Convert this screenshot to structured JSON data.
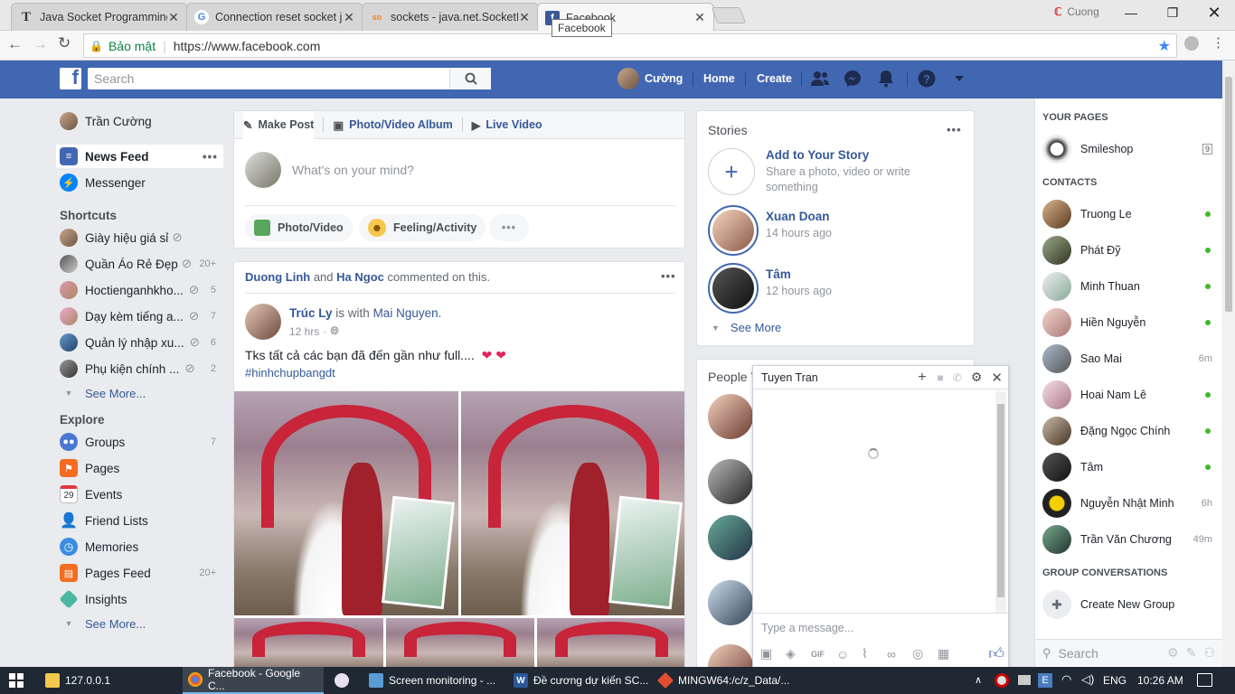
{
  "browser": {
    "tabs": [
      {
        "title": "Java Socket Programming",
        "icon": "T"
      },
      {
        "title": "Connection reset socket j",
        "icon": "G"
      },
      {
        "title": "sockets - java.net.SocketE",
        "icon": "so"
      },
      {
        "title": "Facebook",
        "icon": "f"
      }
    ],
    "tooltip": "Facebook",
    "profile_name": "Cuong",
    "secure_label": "Bảo mật",
    "url": "https://www.facebook.com"
  },
  "fb": {
    "search_placeholder": "Search",
    "user_short": "Cường",
    "nav_home": "Home",
    "nav_create": "Create"
  },
  "left": {
    "profile_name": "Trần Cường",
    "news_feed": "News Feed",
    "messenger": "Messenger",
    "shortcuts_title": "Shortcuts",
    "shortcuts": [
      {
        "label": "Giày hiệu giá sỉ",
        "count": ""
      },
      {
        "label": "Quần Áo Rẻ Đẹp",
        "count": "20+"
      },
      {
        "label": "Hoctienganhkho...",
        "count": "5"
      },
      {
        "label": "Dạy kèm tiếng a...",
        "count": "7"
      },
      {
        "label": "Quản lý nhập xu...",
        "count": "6"
      },
      {
        "label": "Phụ kiện chính ...",
        "count": "2"
      }
    ],
    "see_more": "See More...",
    "explore_title": "Explore",
    "explore": [
      {
        "label": "Groups",
        "count": "7"
      },
      {
        "label": "Pages",
        "count": ""
      },
      {
        "label": "Events",
        "count": ""
      },
      {
        "label": "Friend Lists",
        "count": ""
      },
      {
        "label": "Memories",
        "count": ""
      },
      {
        "label": "Pages Feed",
        "count": "20+"
      },
      {
        "label": "Insights",
        "count": ""
      }
    ],
    "see_more2": "See More...",
    "events_day": "29"
  },
  "composer": {
    "make_post": "Make Post",
    "photo_album": "Photo/Video Album",
    "live_video": "Live Video",
    "placeholder": "What's on your mind?",
    "photo_video": "Photo/Video",
    "feeling": "Feeling/Activity"
  },
  "post": {
    "actor1": "Duong Linh",
    "and": "and",
    "actor2": "Ha Ngoc",
    "action": "commented on this.",
    "author": "Trúc Ly",
    "with": "is with",
    "tagged": "Mai Nguyen.",
    "time": "12 hrs",
    "text": "Tks tất cả các bạn đã đến gần như full....",
    "hashtag": "#hinhchupbangdt"
  },
  "stories": {
    "title": "Stories",
    "add_title": "Add to Your Story",
    "add_sub": "Share a photo, video or write something",
    "items": [
      {
        "name": "Xuan Doan",
        "time": "14 hours ago"
      },
      {
        "name": "Tâm",
        "time": "12 hours ago"
      }
    ],
    "see_more": "See More",
    "people_title": "People Y"
  },
  "chat": {
    "name": "Tuyen Tran",
    "placeholder": "Type a message..."
  },
  "sidebar": {
    "your_pages": "YOUR PAGES",
    "page": {
      "name": "Smileshop",
      "badge": "9"
    },
    "contacts_title": "CONTACTS",
    "contacts": [
      {
        "name": "Truong Le",
        "status": "online",
        "time": ""
      },
      {
        "name": "Phát Đỹ",
        "status": "online",
        "time": ""
      },
      {
        "name": "Minh Thuan",
        "status": "online",
        "time": ""
      },
      {
        "name": "Hiền Nguyễn",
        "status": "online",
        "time": ""
      },
      {
        "name": "Sao Mai",
        "status": "away",
        "time": "6m"
      },
      {
        "name": "Hoai Nam Lê",
        "status": "online",
        "time": ""
      },
      {
        "name": "Đặng Ngọc Chính",
        "status": "online",
        "time": ""
      },
      {
        "name": "Tâm",
        "status": "online",
        "time": ""
      },
      {
        "name": "Nguyễn Nhật Minh",
        "status": "away",
        "time": "6h"
      },
      {
        "name": "Trần Văn Chương",
        "status": "away",
        "time": "49m"
      }
    ],
    "group_title": "GROUP CONVERSATIONS",
    "create_group": "Create New Group",
    "search_placeholder": "Search"
  },
  "taskbar": {
    "items": [
      {
        "label": "127.0.0.1"
      },
      {
        "label": "Facebook - Google C..."
      },
      {
        "label": ""
      },
      {
        "label": "Screen monitoring - ..."
      },
      {
        "label": "Đề cương dự kiến SC..."
      },
      {
        "label": "MINGW64:/c/z_Data/..."
      }
    ],
    "lang": "ENG",
    "time": "10:26 AM"
  },
  "colors": {
    "fb_blue": "#4267b2",
    "link": "#365899",
    "online": "#42b72a"
  }
}
